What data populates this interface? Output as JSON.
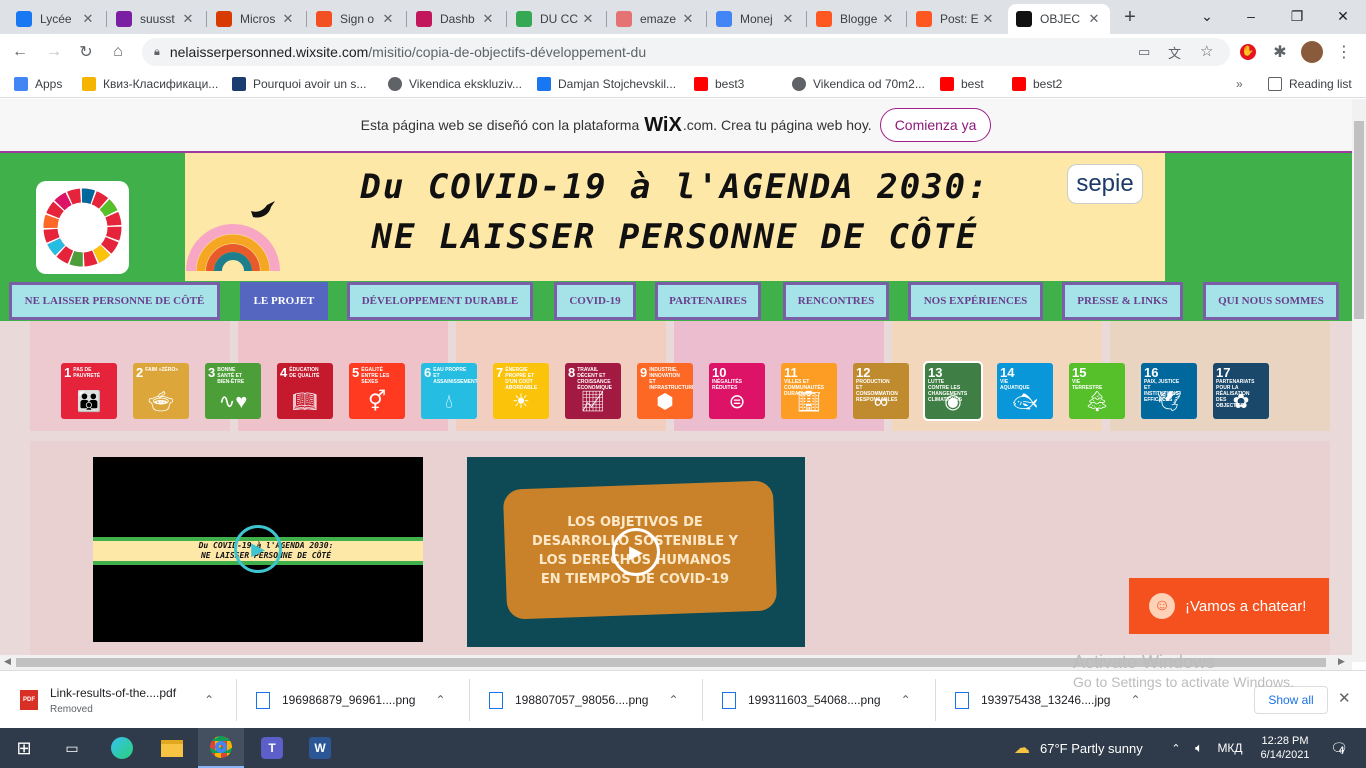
{
  "browser": {
    "tabs": [
      {
        "title": "Lycée",
        "favicon_color": "#1877f2",
        "active": false
      },
      {
        "title": "suusst",
        "favicon_color": "#7b1fa2",
        "active": false
      },
      {
        "title": "Micros",
        "favicon_color": "#d83b01",
        "active": false
      },
      {
        "title": "Sign o",
        "favicon_color": "#f25022",
        "active": false
      },
      {
        "title": "Dashb",
        "favicon_color": "#c2185b",
        "active": false
      },
      {
        "title": "DU CC",
        "favicon_color": "#34a853",
        "active": false
      },
      {
        "title": "emaze",
        "favicon_color": "#e57373",
        "active": false
      },
      {
        "title": "Monej",
        "favicon_color": "#4285f4",
        "active": false
      },
      {
        "title": "Blogge",
        "favicon_color": "#ff5722",
        "active": false
      },
      {
        "title": "Post: E",
        "favicon_color": "#ff5722",
        "active": false
      },
      {
        "title": "OBJEC",
        "favicon_color": "#111111",
        "active": true
      }
    ],
    "new_tab": "+",
    "url_domain": "nelaisserpersonned.wixsite.com",
    "url_path": "/misitio/copia-de-objectifs-développement-du",
    "bookmarks": [
      {
        "label": "Apps",
        "color": "#4285f4"
      },
      {
        "label": "Квиз-Класификаци...",
        "color": "#f4b400"
      },
      {
        "label": "Pourquoi avoir un s...",
        "color": "#1a3c6e"
      },
      {
        "label": "Vikendica ekskluziv...",
        "color": "#5f6368"
      },
      {
        "label": "Damjan Stojchevskil...",
        "color": "#1877f2"
      },
      {
        "label": "best3",
        "color": "#ff0000"
      },
      {
        "label": "Vikendica od 70m2...",
        "color": "#5f6368"
      },
      {
        "label": "best",
        "color": "#ff0000"
      },
      {
        "label": "best2",
        "color": "#ff0000"
      }
    ],
    "reading_list": "Reading list"
  },
  "site": {
    "wix_banner": {
      "text_before": "Esta página web se diseñó con la plataforma",
      "brand": "WiX",
      "text_after": ".com. Crea tu página web hoy.",
      "cta": "Comienza ya"
    },
    "title_line1": "Du COVID-19 à l'AGENDA 2030:",
    "title_line2": "NE LAISSER PERSONNE DE CÔTÉ",
    "partner_logo": "sepie",
    "nav": [
      {
        "label": "NE LAISSER PERSONNE DE CÔTÉ",
        "active": false
      },
      {
        "label": "LE PROJET",
        "active": true
      },
      {
        "label": "DÉVELOPPEMENT DURABLE",
        "active": false
      },
      {
        "label": "COVID-19",
        "active": false
      },
      {
        "label": "PARTENAIRES",
        "active": false
      },
      {
        "label": "RENCONTRES",
        "active": false
      },
      {
        "label": "NOS EXPÉRIENCES",
        "active": false
      },
      {
        "label": "PRESSE & LINKS",
        "active": false
      },
      {
        "label": "QUI NOUS SOMMES",
        "active": false
      }
    ],
    "sdgs": [
      {
        "num": "1",
        "label": "PAS DE PAUVRETÉ",
        "color": "#e5243b",
        "icon": "family-icon"
      },
      {
        "num": "2",
        "label": "FAIM «ZÉRO»",
        "color": "#dda63a",
        "icon": "bowl-icon"
      },
      {
        "num": "3",
        "label": "BONNE SANTÉ ET BIEN-ÊTRE",
        "color": "#4c9f38",
        "icon": "heartbeat-icon"
      },
      {
        "num": "4",
        "label": "ÉDUCATION DE QUALITÉ",
        "color": "#c5192d",
        "icon": "book-icon"
      },
      {
        "num": "5",
        "label": "ÉGALITÉ ENTRE LES SEXES",
        "color": "#ff3a21",
        "icon": "gender-icon"
      },
      {
        "num": "6",
        "label": "EAU PROPRE ET ASSAINISSEMENT",
        "color": "#26bde2",
        "icon": "water-icon"
      },
      {
        "num": "7",
        "label": "ÉNERGIE PROPRE ET D'UN COÛT ABORDABLE",
        "color": "#fcc30b",
        "icon": "sun-icon"
      },
      {
        "num": "8",
        "label": "TRAVAIL DÉCENT ET CROISSANCE ÉCONOMIQUE",
        "color": "#a21942",
        "icon": "growth-icon"
      },
      {
        "num": "9",
        "label": "INDUSTRIE, INNOVATION ET INFRASTRUCTURE",
        "color": "#fd6925",
        "icon": "cubes-icon"
      },
      {
        "num": "10",
        "label": "INÉGALITÉS RÉDUITES",
        "color": "#dd1367",
        "icon": "equal-icon"
      },
      {
        "num": "11",
        "label": "VILLES ET COMMUNAUTÉS DURABLES",
        "color": "#fd9d24",
        "icon": "city-icon"
      },
      {
        "num": "12",
        "label": "PRODUCTION ET CONSOMMATION RESPONSABLES",
        "color": "#bf8b2e",
        "icon": "infinity-icon"
      },
      {
        "num": "13",
        "label": "LUTTE CONTRE LES CHANGEMENTS CLIMATIQUES",
        "color": "#3f7e44",
        "icon": "eye-globe-icon"
      },
      {
        "num": "14",
        "label": "VIE AQUATIQUE",
        "color": "#0a97d9",
        "icon": "fish-icon"
      },
      {
        "num": "15",
        "label": "VIE TERRESTRE",
        "color": "#56c02b",
        "icon": "tree-icon"
      },
      {
        "num": "16",
        "label": "PAIX, JUSTICE ET INSTITUTIONS EFFICACES",
        "color": "#00689d",
        "icon": "dove-icon"
      },
      {
        "num": "17",
        "label": "PARTENARIATS POUR LA RÉALISATION DES OBJECTIFS",
        "color": "#19486a",
        "icon": "flower-icon"
      }
    ],
    "video1": {
      "line1": "Du COVID-19 à l'AGENDA 2030:",
      "line2": "NE LAISSER PERSONNE DE CÔTÉ"
    },
    "video2": {
      "lines": [
        "LOS OBJETIVOS DE",
        "DESARROLLO SOSTENIBLE Y",
        "LOS DERECHOS HUMANOS",
        "EN TIEMPOS DE COVID-19"
      ]
    },
    "chat": "¡Vamos a chatear!"
  },
  "downloads": [
    {
      "name": "Link-results-of-the....pdf",
      "status": "Removed",
      "type": "PDF"
    },
    {
      "name": "196986879_96961....png",
      "status": "",
      "type": "png"
    },
    {
      "name": "198807057_98056....png",
      "status": "",
      "type": "png"
    },
    {
      "name": "199311603_54068....png",
      "status": "",
      "type": "png"
    },
    {
      "name": "193975438_13246....jpg",
      "status": "",
      "type": "jpg"
    }
  ],
  "show_all": "Show all",
  "windows_activation": {
    "title": "Activate Windows",
    "subtitle": "Go to Settings to activate Windows."
  },
  "taskbar": {
    "weather": "67°F  Partly sunny",
    "lang": "МКД",
    "time": "12:28 PM",
    "date": "6/14/2021",
    "notifications": "4"
  }
}
